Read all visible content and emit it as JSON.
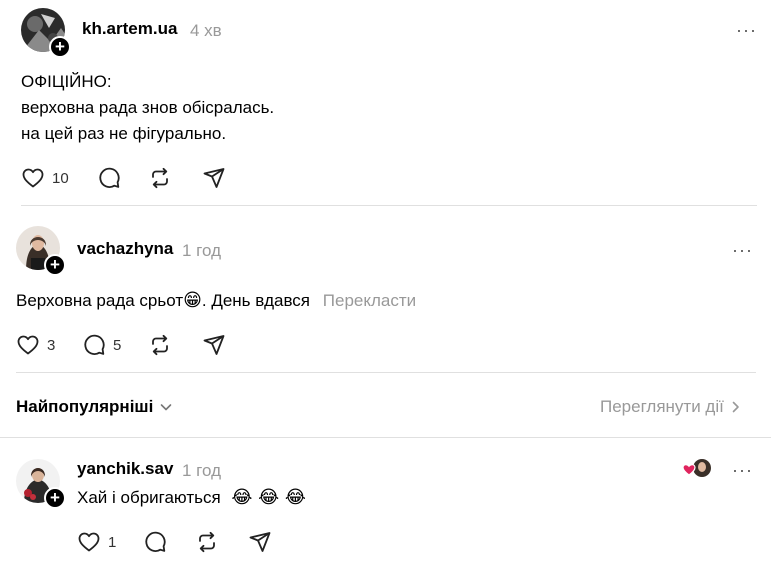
{
  "post1": {
    "username": "kh.artem.ua",
    "time": "4 хв",
    "lines": [
      "ОФІЦІЙНО:",
      "верховна рада знов обісралась.",
      "на цей раз не фігурально."
    ],
    "likes": "10",
    "more": "···"
  },
  "reply1": {
    "username": "vachazhyna",
    "time": "1 год",
    "text": "Верховна рада срьот",
    "emoji": "😁",
    "text_after": ". День вдався",
    "translate": "Перекласти",
    "likes": "3",
    "comments": "5",
    "more": "···"
  },
  "sortbar": {
    "label": "Найпопулярніші",
    "view_all": "Переглянути дії"
  },
  "reply2": {
    "username": "yanchik.sav",
    "time": "1 год",
    "text": "Хай і обригаються",
    "emojis": "😂 😂 😂",
    "likes": "1",
    "more": "···"
  },
  "colors": {
    "muted": "#999999",
    "divider": "#e0e0e0",
    "heart": "#e0245e"
  },
  "icons": [
    "heart-icon",
    "comment-icon",
    "repost-icon",
    "share-icon",
    "more-icon",
    "chevron-down-icon",
    "chevron-right-icon",
    "plus-icon"
  ]
}
